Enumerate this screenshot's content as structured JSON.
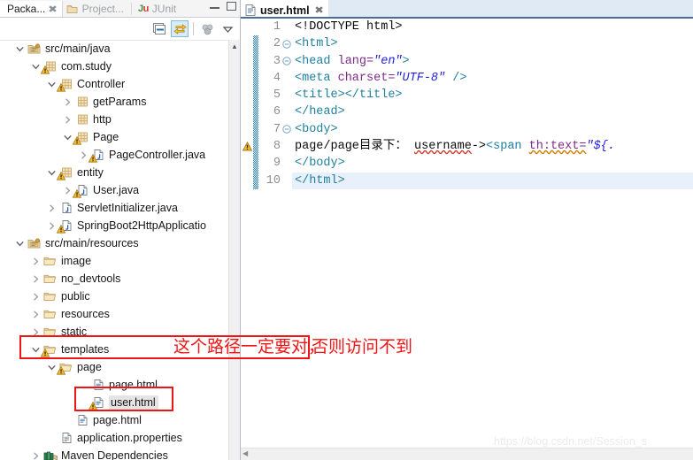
{
  "left_panel": {
    "view_tabs": [
      {
        "label": "Packa...",
        "icon": "package-explorer-icon",
        "active": true,
        "closable": true
      },
      {
        "label": "Project...",
        "icon": "project-explorer-icon",
        "active": false,
        "closable": false
      },
      {
        "label": "JUnit",
        "icon": "junit-icon",
        "active": false,
        "closable": false
      }
    ],
    "window_controls": [
      {
        "name": "minimize-button",
        "glyph": "minimize"
      },
      {
        "name": "maximize-button",
        "glyph": "maximize"
      }
    ],
    "toolbar": [
      {
        "name": "collapse-all-button",
        "icon": "collapse-all-icon",
        "selected": false
      },
      {
        "name": "link-with-editor-button",
        "icon": "link-with-editor-icon",
        "selected": true
      },
      {
        "name": "focus-on-active-task-button",
        "icon": "focus-task-icon",
        "selected": false
      },
      {
        "name": "view-menu-button",
        "icon": "chevron-down-icon",
        "selected": false
      }
    ],
    "tree": [
      {
        "label": "src/main/java",
        "indent": 0,
        "twist": "down",
        "icon": "source-folder-icon",
        "warn": false
      },
      {
        "label": "com.study",
        "indent": 1,
        "twist": "down",
        "icon": "package-icon",
        "warn": true
      },
      {
        "label": "Controller",
        "indent": 2,
        "twist": "down",
        "icon": "package-icon",
        "warn": true
      },
      {
        "label": "getParams",
        "indent": 3,
        "twist": "right",
        "icon": "package-icon",
        "warn": false
      },
      {
        "label": "http",
        "indent": 3,
        "twist": "right",
        "icon": "package-icon",
        "warn": false
      },
      {
        "label": "Page",
        "indent": 3,
        "twist": "down",
        "icon": "package-icon",
        "warn": true
      },
      {
        "label": "PageController.java",
        "indent": 4,
        "twist": "right",
        "icon": "java-file-icon",
        "warn": true
      },
      {
        "label": "entity",
        "indent": 2,
        "twist": "down",
        "icon": "package-icon",
        "warn": true
      },
      {
        "label": "User.java",
        "indent": 3,
        "twist": "right",
        "icon": "java-file-icon",
        "warn": true
      },
      {
        "label": "ServletInitializer.java",
        "indent": 2,
        "twist": "right",
        "icon": "java-file-icon",
        "warn": false
      },
      {
        "label": "SpringBoot2HttpApplicatio",
        "indent": 2,
        "twist": "right",
        "icon": "java-file-icon",
        "warn": true
      },
      {
        "label": "src/main/resources",
        "indent": 0,
        "twist": "down",
        "icon": "source-folder-icon",
        "warn": false
      },
      {
        "label": "image",
        "indent": 1,
        "twist": "right",
        "icon": "folder-icon",
        "warn": false
      },
      {
        "label": "no_devtools",
        "indent": 1,
        "twist": "right",
        "icon": "folder-icon",
        "warn": false
      },
      {
        "label": "public",
        "indent": 1,
        "twist": "right",
        "icon": "folder-icon",
        "warn": false
      },
      {
        "label": "resources",
        "indent": 1,
        "twist": "right",
        "icon": "folder-icon",
        "warn": false
      },
      {
        "label": "static",
        "indent": 1,
        "twist": "right",
        "icon": "folder-icon",
        "warn": false
      },
      {
        "label": "templates",
        "indent": 1,
        "twist": "down",
        "icon": "folder-icon",
        "warn": true
      },
      {
        "label": "page",
        "indent": 2,
        "twist": "down",
        "icon": "folder-icon",
        "warn": true
      },
      {
        "label": "page.html",
        "indent": 4,
        "twist": "none",
        "icon": "html-file-icon",
        "warn": false
      },
      {
        "label": "user.html",
        "indent": 4,
        "twist": "none",
        "icon": "html-file-icon",
        "warn": true,
        "selected": true
      },
      {
        "label": "page.html",
        "indent": 3,
        "twist": "none",
        "icon": "html-file-icon",
        "warn": false
      },
      {
        "label": "application.properties",
        "indent": 2,
        "twist": "none",
        "icon": "properties-file-icon",
        "warn": false
      },
      {
        "label": "Maven Dependencies",
        "indent": 1,
        "twist": "right",
        "icon": "library-icon",
        "warn": false
      }
    ]
  },
  "editor": {
    "tab": {
      "label": "user.html",
      "icon": "html-file-icon",
      "close_glyph": "✖",
      "dirty": false
    },
    "lines": [
      {
        "num": "1",
        "fold": "",
        "warn": false,
        "highlight": false,
        "tokens": [
          {
            "t": "<!DOCTYPE html>",
            "c": "doctype"
          }
        ]
      },
      {
        "num": "2",
        "fold": "⊖",
        "warn": false,
        "highlight": false,
        "tokens": [
          {
            "t": "<html>",
            "c": "tag"
          }
        ]
      },
      {
        "num": "3",
        "fold": "⊖",
        "warn": false,
        "highlight": false,
        "tokens": [
          {
            "t": "<head ",
            "c": "tag"
          },
          {
            "t": "lang=",
            "c": "attr"
          },
          {
            "t": "\"en\"",
            "c": "str"
          },
          {
            "t": ">",
            "c": "tag"
          }
        ]
      },
      {
        "num": "4",
        "fold": "",
        "warn": false,
        "highlight": false,
        "tokens": [
          {
            "t": "<meta ",
            "c": "tag"
          },
          {
            "t": "charset=",
            "c": "attr"
          },
          {
            "t": "\"UTF-8\"",
            "c": "str"
          },
          {
            "t": " />",
            "c": "tag"
          }
        ]
      },
      {
        "num": "5",
        "fold": "",
        "warn": false,
        "highlight": false,
        "tokens": [
          {
            "t": "<title></title>",
            "c": "tag"
          }
        ]
      },
      {
        "num": "6",
        "fold": "",
        "warn": false,
        "highlight": false,
        "tokens": [
          {
            "t": "</head>",
            "c": "tag"
          }
        ]
      },
      {
        "num": "7",
        "fold": "⊖",
        "warn": false,
        "highlight": false,
        "tokens": [
          {
            "t": "<body>",
            "c": "tag"
          }
        ]
      },
      {
        "num": "8",
        "fold": "",
        "warn": true,
        "highlight": false,
        "tokens": [
          {
            "t": "    page/page目录下： ",
            "c": "plain"
          },
          {
            "t": "username",
            "c": "plain squiggle-red"
          },
          {
            "t": "->",
            "c": "plain"
          },
          {
            "t": "<span ",
            "c": "tag"
          },
          {
            "t": "th:text=",
            "c": "attr squiggle"
          },
          {
            "t": "\"${.",
            "c": "str"
          }
        ]
      },
      {
        "num": "9",
        "fold": "",
        "warn": false,
        "highlight": false,
        "tokens": [
          {
            "t": "</body>",
            "c": "tag"
          }
        ]
      },
      {
        "num": "10",
        "fold": "",
        "warn": false,
        "highlight": true,
        "tokens": [
          {
            "t": "</html>",
            "c": "tag"
          }
        ]
      }
    ]
  },
  "annotations": {
    "red_note_1": "这个路径一定要对，",
    "red_note_2": "否则访问不到",
    "box_color": "#f01414"
  },
  "watermark": {
    "text": "https://blog.csdn.net/Session_s"
  }
}
